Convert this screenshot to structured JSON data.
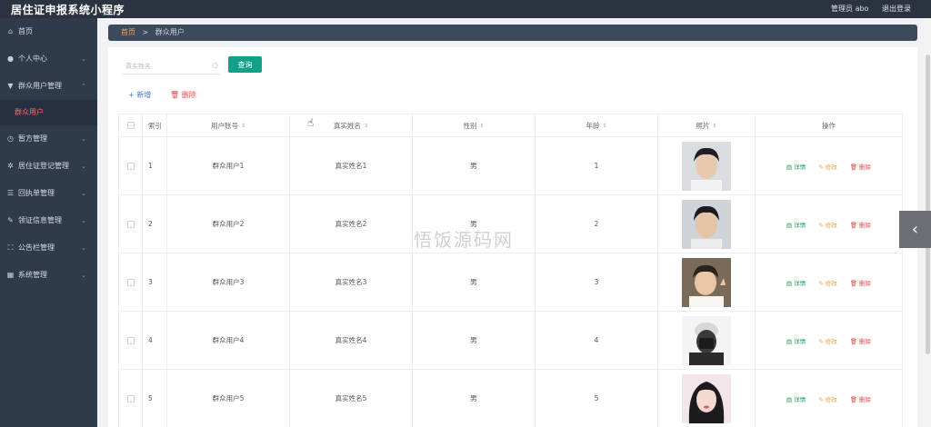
{
  "header": {
    "app_title": "居住证申报系统小程序",
    "role_user": "管理员 abo",
    "logout": "退出登录"
  },
  "sidebar": {
    "items": [
      {
        "label": "首页",
        "icon": "home-icon",
        "has_arrow": false
      },
      {
        "label": "个人中心",
        "icon": "user-icon",
        "has_arrow": true
      },
      {
        "label": "群众用户管理",
        "icon": "users-icon",
        "has_arrow": true,
        "expanded": true
      },
      {
        "label": "暂方管理",
        "icon": "clock-icon",
        "has_arrow": true
      },
      {
        "label": "居住证登记管理",
        "icon": "gear-icon",
        "has_arrow": true
      },
      {
        "label": "回执单管理",
        "icon": "list-icon",
        "has_arrow": true
      },
      {
        "label": "领证信息管理",
        "icon": "badge-icon",
        "has_arrow": true
      },
      {
        "label": "公告栏管理",
        "icon": "board-icon",
        "has_arrow": true
      },
      {
        "label": "系统管理",
        "icon": "grid-icon",
        "has_arrow": true
      }
    ],
    "active_sub": "群众用户"
  },
  "breadcrumb": {
    "home": "首页",
    "separator": ">",
    "current": "群众用户"
  },
  "search": {
    "placeholder": "真实姓名",
    "value": "",
    "button": "查询"
  },
  "actions": {
    "add": "+ 新增",
    "delete": "删除"
  },
  "table": {
    "columns": {
      "index": "索引",
      "account": "用户账号",
      "name": "真实姓名",
      "sex": "性别",
      "age": "年龄",
      "photo": "照片",
      "ops": "操作"
    },
    "ops": {
      "detail": "详情",
      "edit": "修改",
      "delete": "删除"
    },
    "rows": [
      {
        "index": "1",
        "account": "群众用户1",
        "name": "真实姓名1",
        "sex": "男",
        "age": "1"
      },
      {
        "index": "2",
        "account": "群众用户2",
        "name": "真实姓名2",
        "sex": "男",
        "age": "2"
      },
      {
        "index": "3",
        "account": "群众用户3",
        "name": "真实姓名3",
        "sex": "男",
        "age": "3"
      },
      {
        "index": "4",
        "account": "群众用户4",
        "name": "真实姓名4",
        "sex": "男",
        "age": "4"
      },
      {
        "index": "5",
        "account": "群众用户5",
        "name": "真实姓名5",
        "sex": "男",
        "age": "5"
      }
    ]
  },
  "watermark": "悟饭源码网",
  "colors": {
    "topbar": "#2b3341",
    "sidebar": "#2f3a4a",
    "primary_button": "#13a08a",
    "detail": "#19a15f",
    "edit": "#e6a23c",
    "delete": "#e04b4b"
  }
}
